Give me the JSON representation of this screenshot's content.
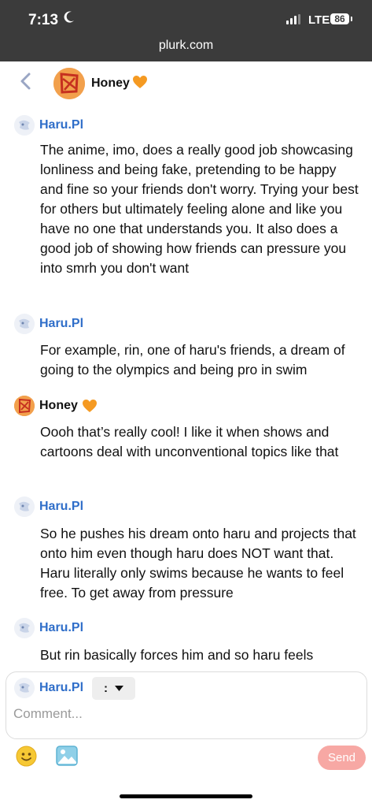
{
  "status_bar": {
    "time": "7:13",
    "network": "LTE",
    "battery": "86"
  },
  "browser": {
    "url": "plurk.com"
  },
  "header": {
    "title": "Honey",
    "accent_color": "#f59a22"
  },
  "messages": [
    {
      "author": "Haru.Pl",
      "text": "The anime, imo, does a really good job showcasing lonliness and being fake, pretending to be happy and fine so your friends don't worry. Trying your best for others but ultimately feeling alone and like you have no one that understands you. It also does a good job of showing how friends can pressure you into smrh you don't want"
    },
    {
      "author": "Haru.Pl",
      "text": "For example, rin, one of haru's friends, a dream of going to the olympics and being pro in swim"
    },
    {
      "author": "Honey",
      "text": "Oooh that’s really cool! I like it when shows and cartoons deal with unconventional topics like that"
    },
    {
      "author": "Haru.Pl",
      "text": "So he pushes his dream onto haru and projects that onto him even though haru does NOT want that. Haru literally only swims because he wants to feel free. To get away from pressure"
    },
    {
      "author": "Haru.Pl",
      "text": "But rin basically forces him and so haru feels"
    }
  ],
  "composer": {
    "author": "Haru.Pl",
    "menu_label": ":",
    "placeholder": "Comment...",
    "send_label": "Send",
    "send_color": "#f7a8a4"
  },
  "colors": {
    "name_blue": "#2f6ec9",
    "topbar": "#3b3b3b"
  }
}
